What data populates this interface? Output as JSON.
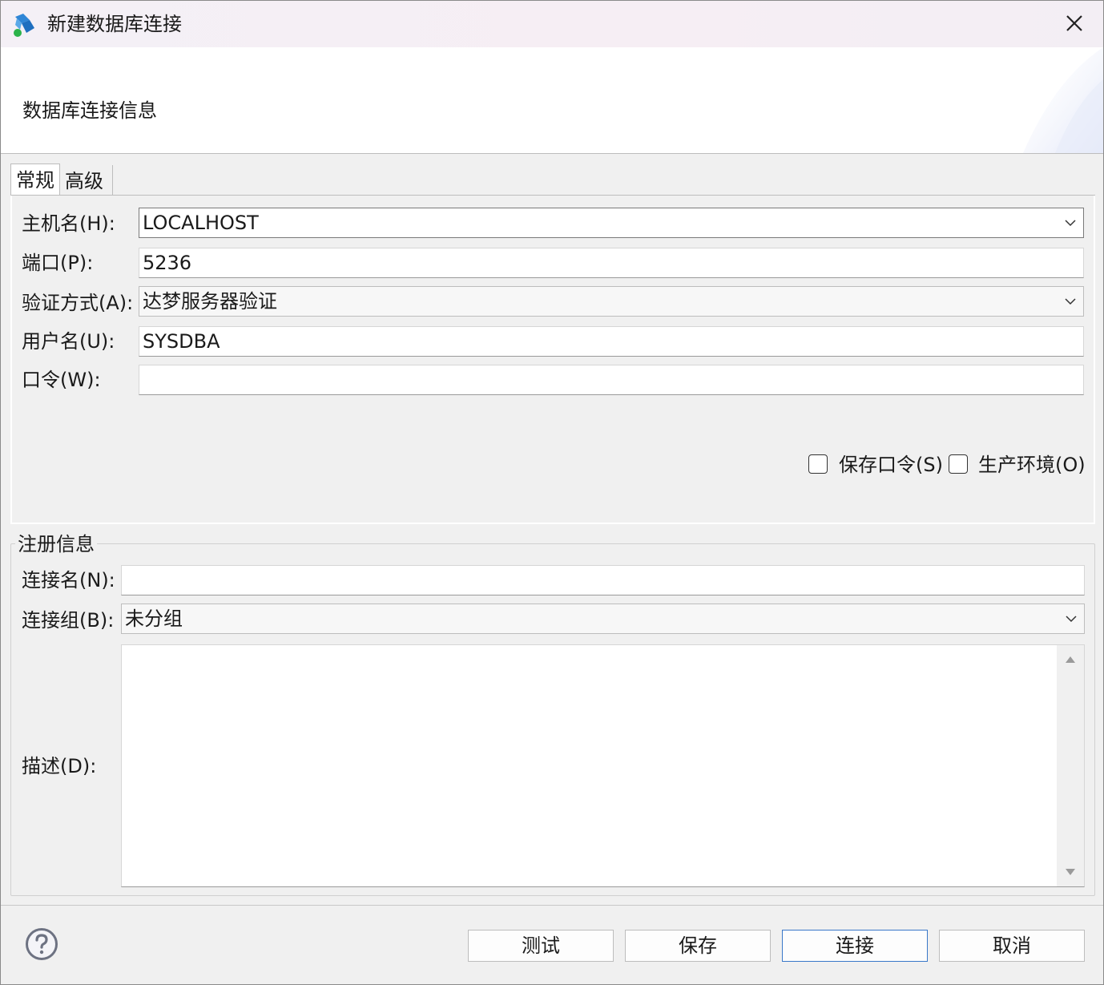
{
  "window": {
    "title": "新建数据库连接"
  },
  "banner": {
    "title": "数据库连接信息"
  },
  "tabs": [
    {
      "label": "常规"
    },
    {
      "label": "高级"
    }
  ],
  "general": {
    "host": {
      "label": "主机名(H):",
      "value": "LOCALHOST"
    },
    "port": {
      "label": "端口(P):",
      "value": "5236"
    },
    "auth": {
      "label": "验证方式(A):",
      "value": "达梦服务器验证"
    },
    "user": {
      "label": "用户名(U):",
      "value": "SYSDBA"
    },
    "password": {
      "label": "口令(W):",
      "value": ""
    },
    "save_password": {
      "label": "保存口令(S)",
      "checked": false
    },
    "production": {
      "label": "生产环境(O)",
      "checked": false
    }
  },
  "registration": {
    "title": "注册信息",
    "name": {
      "label": "连接名(N):",
      "value": ""
    },
    "group": {
      "label": "连接组(B):",
      "value": "未分组"
    },
    "description": {
      "label": "描述(D):",
      "value": ""
    }
  },
  "buttons": {
    "test": "测试",
    "save": "保存",
    "connect": "连接",
    "cancel": "取消"
  },
  "icons": {
    "app": "database-connect-icon",
    "close": "close-icon",
    "help": "help-icon",
    "chevron": "chevron-down-icon"
  }
}
